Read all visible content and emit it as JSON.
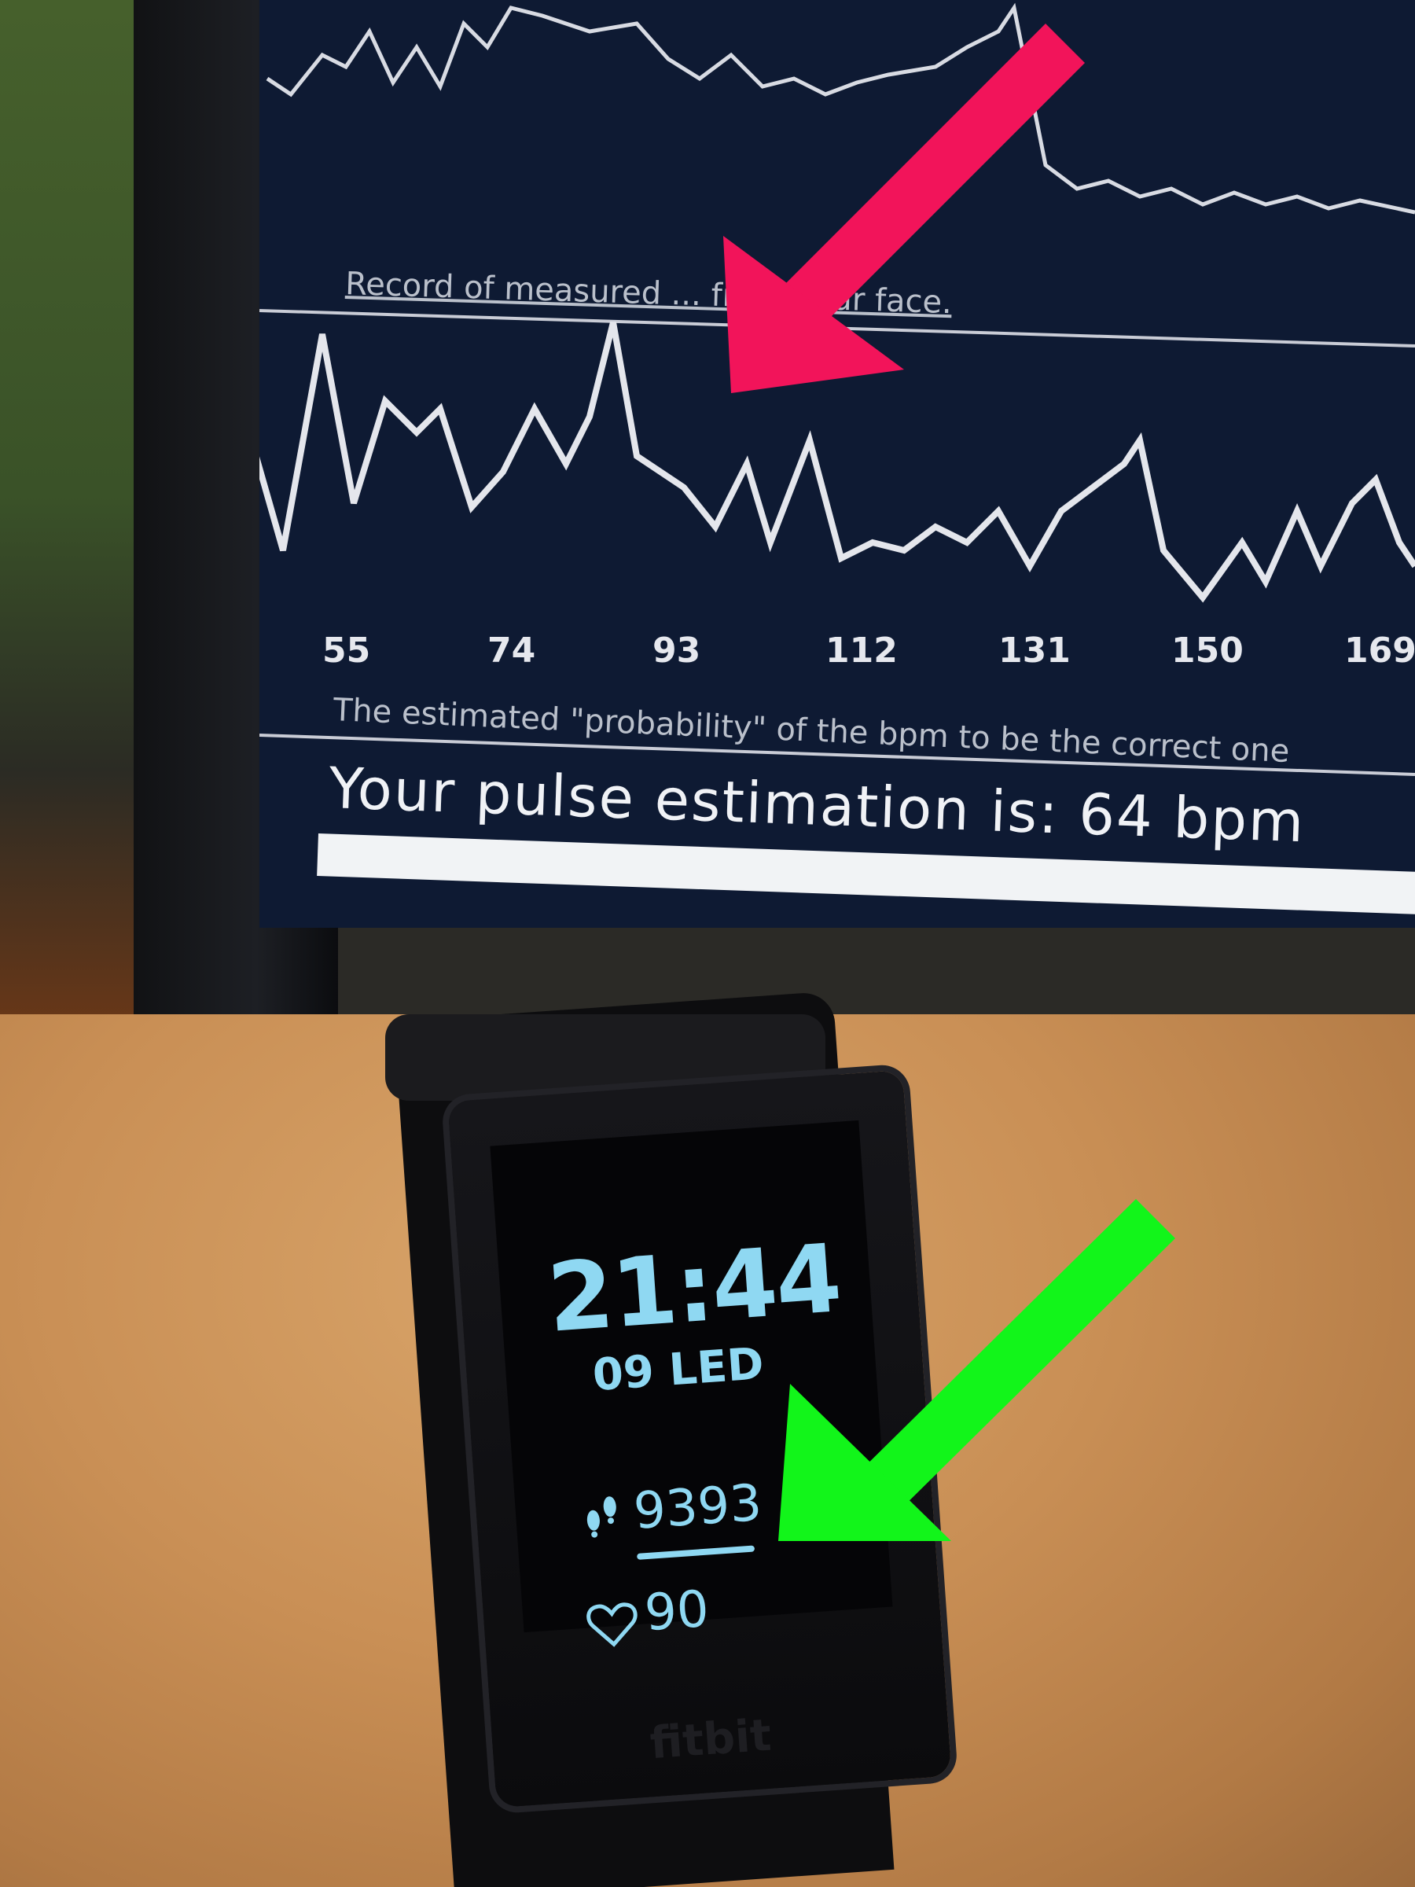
{
  "monitor": {
    "caption_record": "Record of measured ... from your face.",
    "caption_probability": "The estimated \"probability\" of the bpm to be the correct one",
    "pulse_text": "Your pulse estimation is: 64 bpm",
    "x_ticks": [
      "55",
      "74",
      "93",
      "112",
      "131",
      "150",
      "169"
    ]
  },
  "tracker": {
    "time": "21:44",
    "date": "09 LED",
    "steps": "9393",
    "heart_rate": "90",
    "brand": "fitbit",
    "display_color": "#8fd8f2"
  },
  "annotations": {
    "pink_arrow_color": "#f2145a",
    "green_arrow_color": "#12f51a"
  }
}
